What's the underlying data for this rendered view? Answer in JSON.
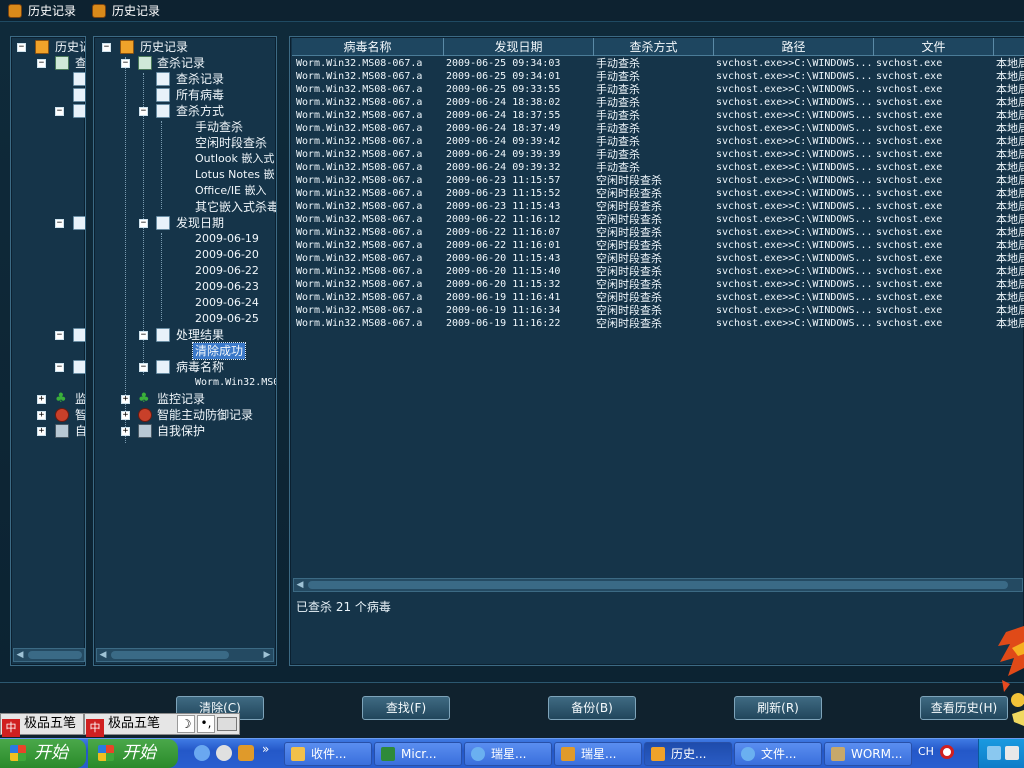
{
  "windows": {
    "title_back": "历史记录",
    "title_front": "历史记录"
  },
  "back_tree": {
    "root_label": "历史记",
    "child_label": "查"
  },
  "tree": {
    "root": "历史记录",
    "scan_records": "查杀记录",
    "view_scan_records": "查杀记录",
    "all_viruses": "所有病毒",
    "scan_method": "查杀方式",
    "methods": [
      "手动查杀",
      "空闲时段查杀",
      "Outlook 嵌入式",
      "Lotus Notes 嵌",
      "Office/IE 嵌入",
      "其它嵌入式杀毒"
    ],
    "discovery_date": "发现日期",
    "dates": [
      "2009-06-19",
      "2009-06-20",
      "2009-06-22",
      "2009-06-23",
      "2009-06-24",
      "2009-06-25"
    ],
    "result": "处理结果",
    "result_item": "清除成功",
    "virus_name": "病毒名称",
    "virus_item": "Worm.Win32.MS0",
    "monitor": "监控记录",
    "active_defense": "智能主动防御记录",
    "self_protect": "自我保护",
    "back_monitor": "监",
    "back_defense": "智",
    "back_protect": "自"
  },
  "table": {
    "columns": [
      "病毒名称",
      "发现日期",
      "查杀方式",
      "路径",
      "文件",
      ""
    ],
    "rows": [
      [
        "Worm.Win32.MS08-067.a",
        "2009-06-25 09:34:03",
        "手动查杀",
        "svchost.exe>>C:\\WINDOWS...",
        "svchost.exe",
        "本地局"
      ],
      [
        "Worm.Win32.MS08-067.a",
        "2009-06-25 09:34:01",
        "手动查杀",
        "svchost.exe>>C:\\WINDOWS...",
        "svchost.exe",
        "本地局"
      ],
      [
        "Worm.Win32.MS08-067.a",
        "2009-06-25 09:33:55",
        "手动查杀",
        "svchost.exe>>C:\\WINDOWS...",
        "svchost.exe",
        "本地局"
      ],
      [
        "Worm.Win32.MS08-067.a",
        "2009-06-24 18:38:02",
        "手动查杀",
        "svchost.exe>>C:\\WINDOWS...",
        "svchost.exe",
        "本地局"
      ],
      [
        "Worm.Win32.MS08-067.a",
        "2009-06-24 18:37:55",
        "手动查杀",
        "svchost.exe>>C:\\WINDOWS...",
        "svchost.exe",
        "本地局"
      ],
      [
        "Worm.Win32.MS08-067.a",
        "2009-06-24 18:37:49",
        "手动查杀",
        "svchost.exe>>C:\\WINDOWS...",
        "svchost.exe",
        "本地局"
      ],
      [
        "Worm.Win32.MS08-067.a",
        "2009-06-24 09:39:42",
        "手动查杀",
        "svchost.exe>>C:\\WINDOWS...",
        "svchost.exe",
        "本地局"
      ],
      [
        "Worm.Win32.MS08-067.a",
        "2009-06-24 09:39:39",
        "手动查杀",
        "svchost.exe>>C:\\WINDOWS...",
        "svchost.exe",
        "本地局"
      ],
      [
        "Worm.Win32.MS08-067.a",
        "2009-06-24 09:39:32",
        "手动查杀",
        "svchost.exe>>C:\\WINDOWS...",
        "svchost.exe",
        "本地局"
      ],
      [
        "Worm.Win32.MS08-067.a",
        "2009-06-23 11:15:57",
        "空闲时段查杀",
        "svchost.exe>>C:\\WINDOWS...",
        "svchost.exe",
        "本地局"
      ],
      [
        "Worm.Win32.MS08-067.a",
        "2009-06-23 11:15:52",
        "空闲时段查杀",
        "svchost.exe>>C:\\WINDOWS...",
        "svchost.exe",
        "本地局"
      ],
      [
        "Worm.Win32.MS08-067.a",
        "2009-06-23 11:15:43",
        "空闲时段查杀",
        "svchost.exe>>C:\\WINDOWS...",
        "svchost.exe",
        "本地局"
      ],
      [
        "Worm.Win32.MS08-067.a",
        "2009-06-22 11:16:12",
        "空闲时段查杀",
        "svchost.exe>>C:\\WINDOWS...",
        "svchost.exe",
        "本地局"
      ],
      [
        "Worm.Win32.MS08-067.a",
        "2009-06-22 11:16:07",
        "空闲时段查杀",
        "svchost.exe>>C:\\WINDOWS...",
        "svchost.exe",
        "本地局"
      ],
      [
        "Worm.Win32.MS08-067.a",
        "2009-06-22 11:16:01",
        "空闲时段查杀",
        "svchost.exe>>C:\\WINDOWS...",
        "svchost.exe",
        "本地局"
      ],
      [
        "Worm.Win32.MS08-067.a",
        "2009-06-20 11:15:43",
        "空闲时段查杀",
        "svchost.exe>>C:\\WINDOWS...",
        "svchost.exe",
        "本地局"
      ],
      [
        "Worm.Win32.MS08-067.a",
        "2009-06-20 11:15:40",
        "空闲时段查杀",
        "svchost.exe>>C:\\WINDOWS...",
        "svchost.exe",
        "本地局"
      ],
      [
        "Worm.Win32.MS08-067.a",
        "2009-06-20 11:15:32",
        "空闲时段查杀",
        "svchost.exe>>C:\\WINDOWS...",
        "svchost.exe",
        "本地局"
      ],
      [
        "Worm.Win32.MS08-067.a",
        "2009-06-19 11:16:41",
        "空闲时段查杀",
        "svchost.exe>>C:\\WINDOWS...",
        "svchost.exe",
        "本地局"
      ],
      [
        "Worm.Win32.MS08-067.a",
        "2009-06-19 11:16:34",
        "空闲时段查杀",
        "svchost.exe>>C:\\WINDOWS...",
        "svchost.exe",
        "本地局"
      ],
      [
        "Worm.Win32.MS08-067.a",
        "2009-06-19 11:16:22",
        "空闲时段查杀",
        "svchost.exe>>C:\\WINDOWS...",
        "svchost.exe",
        "本地局"
      ]
    ]
  },
  "status": "已查杀 21 个病毒",
  "buttons": {
    "clear": "清除(C)",
    "find": "查找(F)",
    "backup": "备份(B)",
    "refresh": "刷新(R)",
    "view_history": "查看历史(H)"
  },
  "ime": {
    "label_1": "极品五笔",
    "label_2": "极品五笔",
    "mark": "中"
  },
  "taskbar": {
    "start_1": "开始",
    "start_2": "开始",
    "more": "»",
    "tasks": [
      "收件...",
      "Micr...",
      "瑞星...",
      "瑞星...",
      "历史...",
      "文件...",
      "WORM..."
    ],
    "lang": "CH"
  },
  "colors": {
    "window_bg": "#153449",
    "selection": "#3a78c8",
    "taskbar": "#2458c8",
    "start": "#2a8a2a"
  }
}
